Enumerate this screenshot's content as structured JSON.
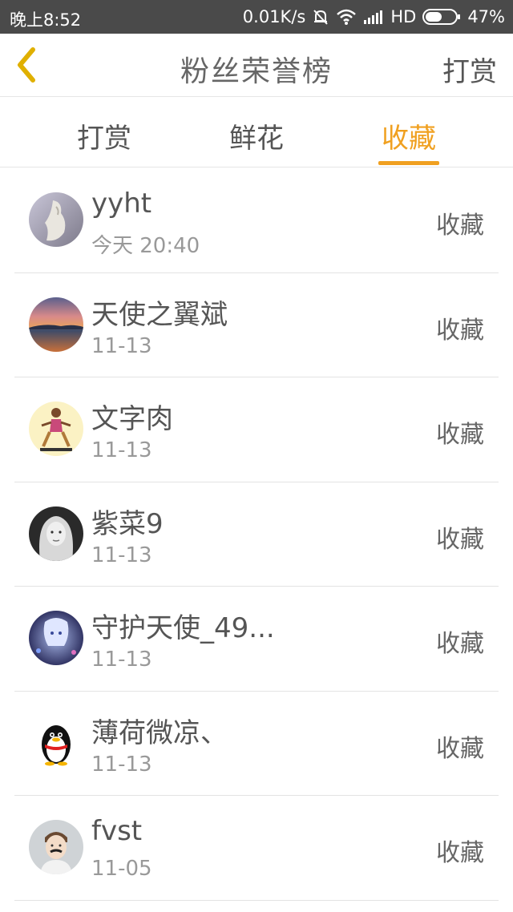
{
  "status_bar": {
    "time": "晚上8:52",
    "speed": "0.01K/s",
    "network": "HD",
    "battery": "47%"
  },
  "header": {
    "title": "粉丝荣誉榜",
    "action_label": "打赏",
    "back_icon": "chevron-left-icon"
  },
  "tabs": [
    {
      "label": "打赏",
      "active": false
    },
    {
      "label": "鲜花",
      "active": false
    },
    {
      "label": "收藏",
      "active": true
    }
  ],
  "colors": {
    "accent": "#f0a020",
    "status_bar": "#4a4a4a"
  },
  "fans": [
    {
      "name": "yyht",
      "date": "今天 20:40",
      "type": "收藏",
      "avatar": "sculpture-avatar"
    },
    {
      "name": "天使之翼斌",
      "date": "11-13",
      "type": "收藏",
      "avatar": "sunset-avatar"
    },
    {
      "name": "文字肉",
      "date": "11-13",
      "type": "收藏",
      "avatar": "cartoon-avatar"
    },
    {
      "name": "紫菜9",
      "date": "11-13",
      "type": "收藏",
      "avatar": "portrait-avatar"
    },
    {
      "name": "守护天使_49...",
      "date": "11-13",
      "type": "收藏",
      "avatar": "anime-avatar"
    },
    {
      "name": "薄荷微凉、",
      "date": "11-13",
      "type": "收藏",
      "avatar": "penguin-avatar"
    },
    {
      "name": "fvst",
      "date": "11-05",
      "type": "收藏",
      "avatar": "child-avatar"
    }
  ]
}
